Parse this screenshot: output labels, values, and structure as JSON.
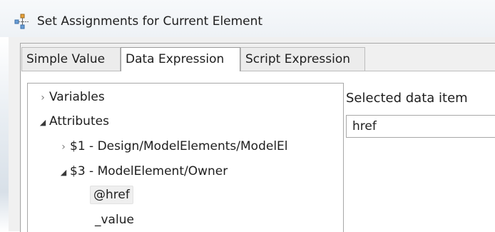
{
  "window": {
    "title": "Set Assignments for Current Element"
  },
  "tabs": [
    {
      "label": "Simple Value"
    },
    {
      "label": "Data Expression"
    },
    {
      "label": "Script Expression"
    }
  ],
  "tree": {
    "variables": {
      "label": "Variables"
    },
    "attributes": {
      "label": "Attributes"
    },
    "item1": {
      "label": "$1 - Design/ModelElements/ModelEl"
    },
    "item3": {
      "label": "$3 - ModelElement/Owner"
    },
    "href": {
      "label": "@href"
    },
    "value": {
      "label": "_value"
    }
  },
  "selected": {
    "label": "Selected data item",
    "value": "href"
  }
}
